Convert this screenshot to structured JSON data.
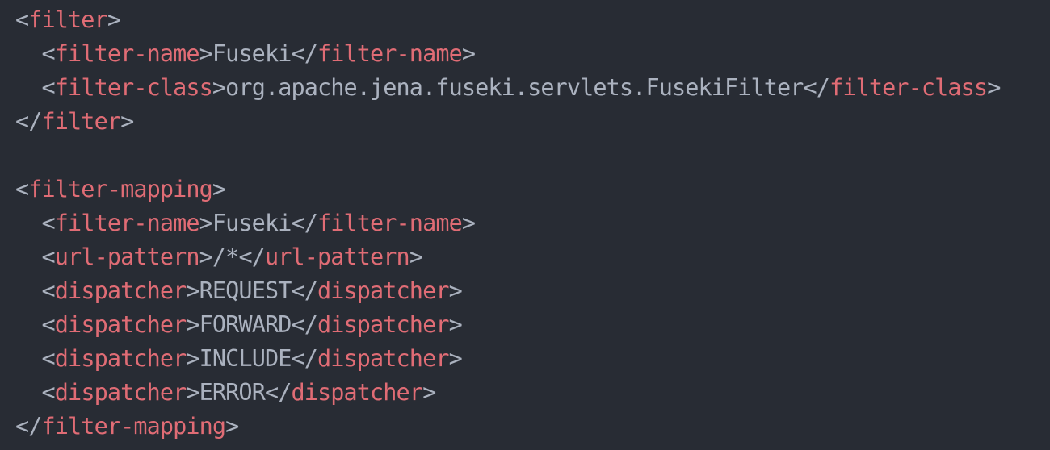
{
  "code": {
    "lines": [
      {
        "indent": "",
        "tokens": [
          {
            "t": "punct",
            "v": "<"
          },
          {
            "t": "tag",
            "v": "filter"
          },
          {
            "t": "punct",
            "v": ">"
          }
        ]
      },
      {
        "indent": "  ",
        "tokens": [
          {
            "t": "punct",
            "v": "<"
          },
          {
            "t": "tag",
            "v": "filter-name"
          },
          {
            "t": "punct",
            "v": ">"
          },
          {
            "t": "text",
            "v": "Fuseki"
          },
          {
            "t": "punct",
            "v": "</"
          },
          {
            "t": "tag",
            "v": "filter-name"
          },
          {
            "t": "punct",
            "v": ">"
          }
        ]
      },
      {
        "indent": "  ",
        "tokens": [
          {
            "t": "punct",
            "v": "<"
          },
          {
            "t": "tag",
            "v": "filter-class"
          },
          {
            "t": "punct",
            "v": ">"
          },
          {
            "t": "text",
            "v": "org.apache.jena.fuseki.servlets.FusekiFilter"
          },
          {
            "t": "punct",
            "v": "</"
          },
          {
            "t": "tag",
            "v": "filter-class"
          },
          {
            "t": "punct",
            "v": ">"
          }
        ]
      },
      {
        "indent": "",
        "tokens": [
          {
            "t": "punct",
            "v": "</"
          },
          {
            "t": "tag",
            "v": "filter"
          },
          {
            "t": "punct",
            "v": ">"
          }
        ]
      },
      {
        "indent": "",
        "tokens": []
      },
      {
        "indent": "",
        "tokens": [
          {
            "t": "punct",
            "v": "<"
          },
          {
            "t": "tag",
            "v": "filter-mapping"
          },
          {
            "t": "punct",
            "v": ">"
          }
        ]
      },
      {
        "indent": "  ",
        "tokens": [
          {
            "t": "punct",
            "v": "<"
          },
          {
            "t": "tag",
            "v": "filter-name"
          },
          {
            "t": "punct",
            "v": ">"
          },
          {
            "t": "text",
            "v": "Fuseki"
          },
          {
            "t": "punct",
            "v": "</"
          },
          {
            "t": "tag",
            "v": "filter-name"
          },
          {
            "t": "punct",
            "v": ">"
          }
        ]
      },
      {
        "indent": "  ",
        "tokens": [
          {
            "t": "punct",
            "v": "<"
          },
          {
            "t": "tag",
            "v": "url-pattern"
          },
          {
            "t": "punct",
            "v": ">"
          },
          {
            "t": "text",
            "v": "/*"
          },
          {
            "t": "punct",
            "v": "</"
          },
          {
            "t": "tag",
            "v": "url-pattern"
          },
          {
            "t": "punct",
            "v": ">"
          }
        ]
      },
      {
        "indent": "  ",
        "tokens": [
          {
            "t": "punct",
            "v": "<"
          },
          {
            "t": "tag",
            "v": "dispatcher"
          },
          {
            "t": "punct",
            "v": ">"
          },
          {
            "t": "text",
            "v": "REQUEST"
          },
          {
            "t": "punct",
            "v": "</"
          },
          {
            "t": "tag",
            "v": "dispatcher"
          },
          {
            "t": "punct",
            "v": ">"
          }
        ]
      },
      {
        "indent": "  ",
        "tokens": [
          {
            "t": "punct",
            "v": "<"
          },
          {
            "t": "tag",
            "v": "dispatcher"
          },
          {
            "t": "punct",
            "v": ">"
          },
          {
            "t": "text",
            "v": "FORWARD"
          },
          {
            "t": "punct",
            "v": "</"
          },
          {
            "t": "tag",
            "v": "dispatcher"
          },
          {
            "t": "punct",
            "v": ">"
          }
        ]
      },
      {
        "indent": "  ",
        "tokens": [
          {
            "t": "punct",
            "v": "<"
          },
          {
            "t": "tag",
            "v": "dispatcher"
          },
          {
            "t": "punct",
            "v": ">"
          },
          {
            "t": "text",
            "v": "INCLUDE"
          },
          {
            "t": "punct",
            "v": "</"
          },
          {
            "t": "tag",
            "v": "dispatcher"
          },
          {
            "t": "punct",
            "v": ">"
          }
        ]
      },
      {
        "indent": "  ",
        "tokens": [
          {
            "t": "punct",
            "v": "<"
          },
          {
            "t": "tag",
            "v": "dispatcher"
          },
          {
            "t": "punct",
            "v": ">"
          },
          {
            "t": "text",
            "v": "ERROR"
          },
          {
            "t": "punct",
            "v": "</"
          },
          {
            "t": "tag",
            "v": "dispatcher"
          },
          {
            "t": "punct",
            "v": ">"
          }
        ]
      },
      {
        "indent": "",
        "tokens": [
          {
            "t": "punct",
            "v": "</"
          },
          {
            "t": "tag",
            "v": "filter-mapping"
          },
          {
            "t": "punct",
            "v": ">"
          }
        ]
      }
    ]
  },
  "colors": {
    "background": "#282c34",
    "tag": "#e06c75",
    "punctuation": "#abb2bf",
    "text": "#abb2bf"
  }
}
